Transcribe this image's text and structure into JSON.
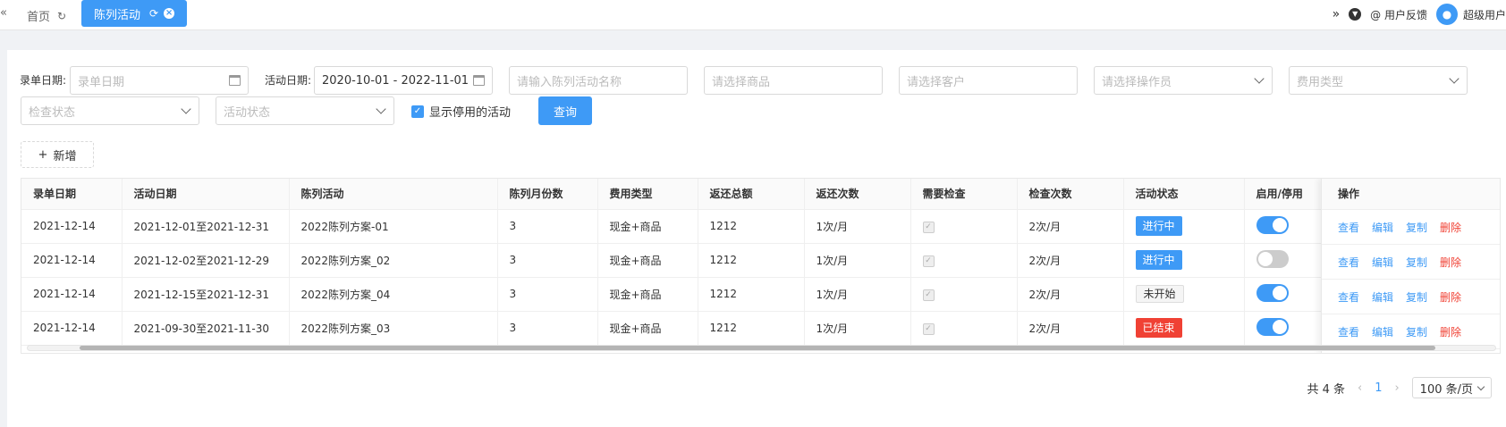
{
  "topbar": {
    "home_tab": "首页",
    "active_tab": "陈列活动",
    "feedback": "@ 用户反馈",
    "user": "超级用户"
  },
  "filters": {
    "entry_date_label": "录单日期:",
    "entry_date_placeholder": "录单日期",
    "activity_date_label": "活动日期:",
    "activity_date_value": "2020-10-01 - 2022-11-01",
    "activity_name_placeholder": "请输入陈列活动名称",
    "product_placeholder": "请选择商品",
    "customer_placeholder": "请选择客户",
    "operator_placeholder": "请选择操作员",
    "fee_type_placeholder": "费用类型",
    "check_status_placeholder": "检查状态",
    "activity_status_placeholder": "活动状态",
    "show_disabled_label": "显示停用的活动",
    "query_button": "查询",
    "add_button": "新增"
  },
  "table": {
    "columns": [
      "录单日期",
      "活动日期",
      "陈列活动",
      "陈列月份数",
      "费用类型",
      "返还总额",
      "返还次数",
      "需要检查",
      "检查次数",
      "活动状态",
      "启用/停用"
    ],
    "ops_header": "操作",
    "rows": [
      {
        "entry": "2021-12-14",
        "period": "2021-12-01至2021-12-31",
        "name": "2022陈列方案-01",
        "months": "3",
        "fee": "现金+商品",
        "total": "1212",
        "times": "1次/月",
        "need_check": true,
        "check_times": "2次/月",
        "status": "进行中",
        "status_kind": "running",
        "enabled": true
      },
      {
        "entry": "2021-12-14",
        "period": "2021-12-02至2021-12-29",
        "name": "2022陈列方案_02",
        "months": "3",
        "fee": "现金+商品",
        "total": "1212",
        "times": "1次/月",
        "need_check": true,
        "check_times": "2次/月",
        "status": "进行中",
        "status_kind": "running",
        "enabled": false
      },
      {
        "entry": "2021-12-14",
        "period": "2021-12-15至2021-12-31",
        "name": "2022陈列方案_04",
        "months": "3",
        "fee": "现金+商品",
        "total": "1212",
        "times": "1次/月",
        "need_check": true,
        "check_times": "2次/月",
        "status": "未开始",
        "status_kind": "pending",
        "enabled": true
      },
      {
        "entry": "2021-12-14",
        "period": "2021-09-30至2021-11-30",
        "name": "2022陈列方案_03",
        "months": "3",
        "fee": "现金+商品",
        "total": "1212",
        "times": "1次/月",
        "need_check": true,
        "check_times": "2次/月",
        "status": "已结束",
        "status_kind": "ended",
        "enabled": true
      }
    ],
    "ops": {
      "view": "查看",
      "edit": "编辑",
      "copy": "复制",
      "delete": "删除"
    }
  },
  "pagination": {
    "total_text": "共 4 条",
    "current_page": "1",
    "page_size": "100 条/页"
  },
  "colors": {
    "primary": "#3e9af6",
    "danger": "#f04134"
  }
}
